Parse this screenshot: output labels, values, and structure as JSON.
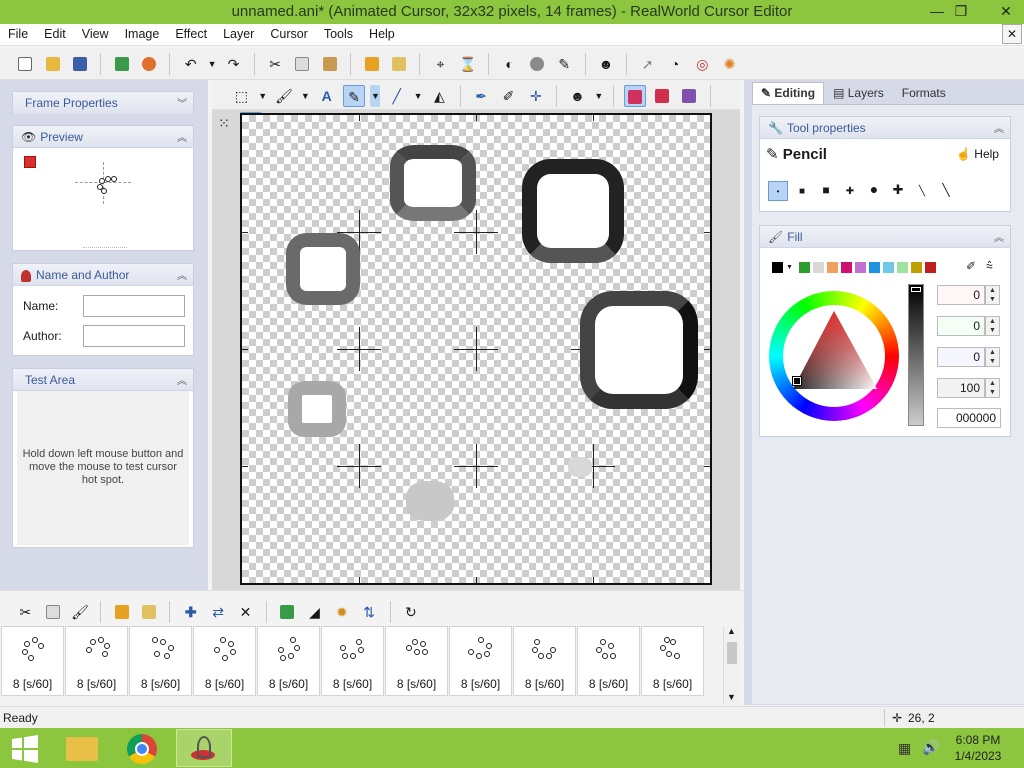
{
  "window": {
    "title": "unnamed.ani* (Animated Cursor, 32x32 pixels, 14 frames) - RealWorld Cursor Editor",
    "minimize_glyph": "—",
    "restore_glyph": "❐",
    "close_glyph": "✕"
  },
  "menu": {
    "items": [
      "File",
      "Edit",
      "View",
      "Image",
      "Effect",
      "Layer",
      "Cursor",
      "Tools",
      "Help"
    ],
    "mdi_close_glyph": "✕"
  },
  "left_panel": {
    "frame_properties": {
      "title": "Frame Properties"
    },
    "preview": {
      "title": "Preview"
    },
    "name_author": {
      "title": "Name and Author",
      "name_label": "Name:",
      "name_value": "",
      "author_label": "Author:",
      "author_value": ""
    },
    "test_area": {
      "title": "Test Area",
      "hint": "Hold down left mouse button and move the mouse to test cursor hot spot."
    }
  },
  "right_panel": {
    "tabs": [
      "Editing",
      "Layers",
      "Formats"
    ],
    "active_tab": "Editing",
    "tool_properties": {
      "title": "Tool properties",
      "tool_name": "Pencil",
      "help_label": "Help"
    },
    "fill": {
      "title": "Fill",
      "values": [
        "0",
        "0",
        "0",
        "100",
        "000000"
      ],
      "palette": [
        "#000000",
        "#2e9e2e",
        "#d8d8d8",
        "#f0a060",
        "#d01070",
        "#c070d0",
        "#2090e0",
        "#70c8e8",
        "#a0e0a0",
        "#c0a000",
        "#c02020"
      ]
    }
  },
  "frames": {
    "items": [
      {
        "label": "8 [s/60]"
      },
      {
        "label": "8 [s/60]"
      },
      {
        "label": "8 [s/60]"
      },
      {
        "label": "8 [s/60]"
      },
      {
        "label": "8 [s/60]"
      },
      {
        "label": "8 [s/60]"
      },
      {
        "label": "8 [s/60]"
      },
      {
        "label": "8 [s/60]"
      },
      {
        "label": "8 [s/60]"
      },
      {
        "label": "8 [s/60]"
      },
      {
        "label": "8 [s/60]"
      }
    ]
  },
  "status": {
    "text": "Ready",
    "coords": "26, 2"
  },
  "taskbar": {
    "time": "6:08 PM",
    "date": "1/4/2023"
  },
  "colors": {
    "title_bar": "#8cc63f",
    "panel_bg": "#d6dae8",
    "panel_header_text": "#3b5a9a"
  }
}
